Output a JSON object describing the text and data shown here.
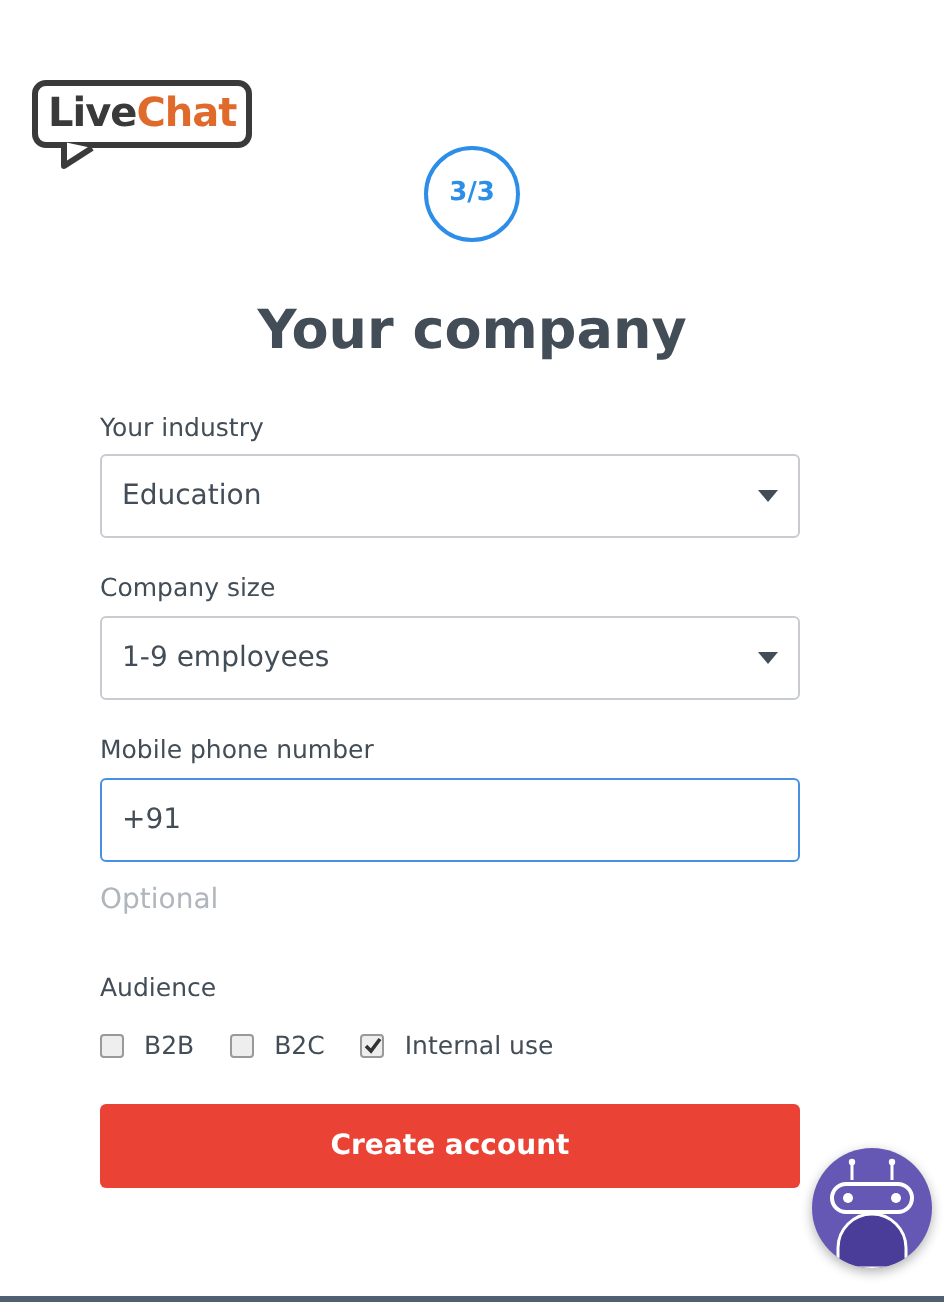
{
  "logo": {
    "part_1": "Live",
    "part_2": "Chat"
  },
  "step": "3/3",
  "title": "Your company",
  "fields": [
    {
      "kind": "select",
      "label": "Your industry",
      "value": "Education",
      "focused": false
    },
    {
      "kind": "select",
      "label": "Company size",
      "value": "1-9 employees",
      "focused": false
    },
    {
      "kind": "input",
      "label": "Mobile phone number",
      "value": "+91",
      "focused": true,
      "hint": "Optional"
    }
  ],
  "audience": {
    "label": "Audience",
    "options": [
      {
        "label": "B2B",
        "checked": false
      },
      {
        "label": "B2C",
        "checked": false
      },
      {
        "label": "Internal use",
        "checked": true
      }
    ]
  },
  "submit": "Create account"
}
